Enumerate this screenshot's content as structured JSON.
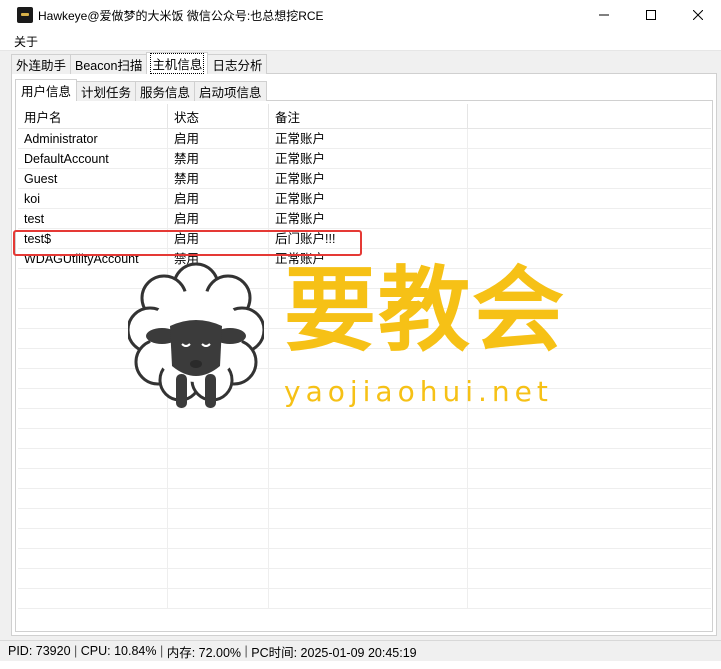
{
  "window": {
    "title": "Hawkeye@爱做梦的大米饭 微信公众号:也总想挖RCE"
  },
  "menubar": {
    "items": [
      {
        "label": "关于"
      }
    ]
  },
  "main_tabs": [
    {
      "label": "外连助手"
    },
    {
      "label": "Beacon扫描"
    },
    {
      "label": "主机信息"
    },
    {
      "label": "日志分析"
    }
  ],
  "sub_tabs": [
    {
      "label": "用户信息"
    },
    {
      "label": "计划任务"
    },
    {
      "label": "服务信息"
    },
    {
      "label": "启动项信息"
    }
  ],
  "table": {
    "headers": [
      "用户名",
      "状态",
      "备注"
    ],
    "rows": [
      [
        "Administrator",
        "启用",
        "正常账户"
      ],
      [
        "DefaultAccount",
        "禁用",
        "正常账户"
      ],
      [
        "Guest",
        "禁用",
        "正常账户"
      ],
      [
        "koi",
        "启用",
        "正常账户"
      ],
      [
        "test",
        "启用",
        "正常账户"
      ],
      [
        "test$",
        "启用",
        "后门账户!!!"
      ],
      [
        "WDAGUtilityAccount",
        "禁用",
        "正常账户"
      ]
    ]
  },
  "watermark": {
    "chinese": "要教会",
    "domain": "yaojiaohui.net"
  },
  "statusbar": {
    "pid": "PID: 73920",
    "cpu": "CPU: 10.84%",
    "memory": "内存: 72.00%",
    "pc_time": "PC时间: 2025-01-09 20:45:19"
  },
  "colors": {
    "highlight": "#e53935",
    "watermark": "#f6c116"
  }
}
